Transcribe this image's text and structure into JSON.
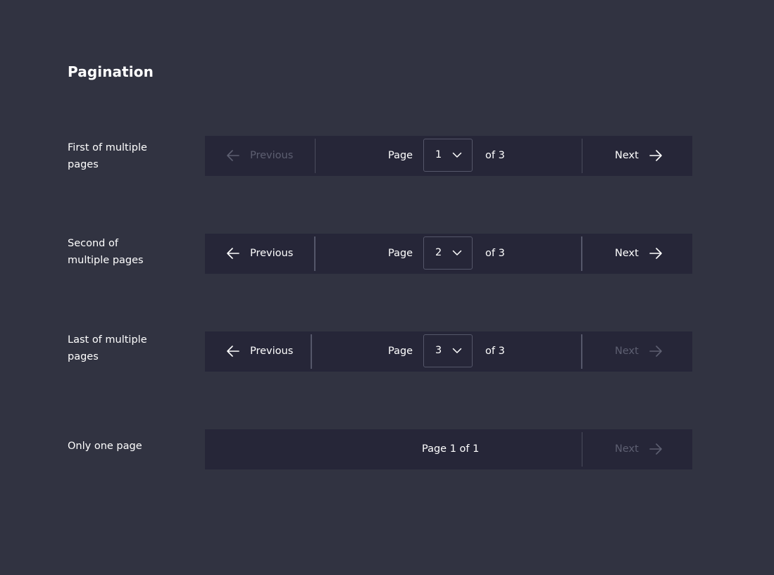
{
  "title": "Pagination",
  "colors": {
    "background": "#313341",
    "bar": "#262638",
    "text": "#ffffff",
    "disabled_text": "#5d5f71",
    "divider": "#4a4c5c"
  },
  "rows": [
    {
      "label_line1": "First of multiple",
      "label_line2": "pages",
      "prev_label": "Previous",
      "prev_disabled": true,
      "page_word": "Page",
      "selected_page": "1",
      "of_total": "of 3",
      "next_label": "Next",
      "next_disabled": false,
      "icons": {
        "prev": "arrow-left-icon",
        "chevron": "chevron-down-icon",
        "next": "arrow-right-icon"
      }
    },
    {
      "label_line1": "Second of",
      "label_line2": "multiple pages",
      "prev_label": "Previous",
      "prev_disabled": false,
      "page_word": "Page",
      "selected_page": "2",
      "of_total": "of 3",
      "next_label": "Next",
      "next_disabled": false,
      "icons": {
        "prev": "arrow-left-icon",
        "chevron": "chevron-down-icon",
        "next": "arrow-right-icon"
      }
    },
    {
      "label_line1": "Last of multiple",
      "label_line2": "pages",
      "prev_label": "Previous",
      "prev_disabled": false,
      "page_word": "Page",
      "selected_page": "3",
      "of_total": "of 3",
      "next_label": "Next",
      "next_disabled": true,
      "icons": {
        "prev": "arrow-left-icon",
        "chevron": "chevron-down-icon",
        "next": "arrow-right-icon"
      }
    },
    {
      "label_line1": "Only one page",
      "status": "Page 1 of 1",
      "next_label": "Next",
      "next_disabled": true,
      "icons": {
        "next": "arrow-right-icon"
      }
    }
  ]
}
